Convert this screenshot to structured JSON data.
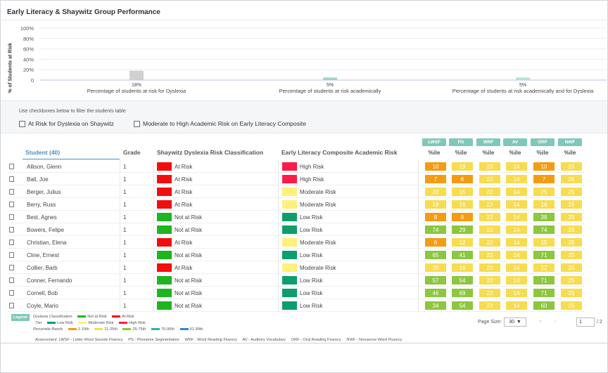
{
  "title": "Early Literacy & Shaywitz Group Performance",
  "colors": {
    "at_risk": "#f30e0e",
    "not_at_risk": "#1eb51e",
    "high_risk": "#ff1b47",
    "moderate_risk": "#fff07a",
    "low_risk": "#0c9e6c",
    "band_1_10": "#f39c12",
    "band_11_25": "#f7dc4f",
    "band_26_75": "#8dc63f",
    "band_76_90": "#2bb5a5",
    "band_91_99": "#2e8bc0"
  },
  "chart_data": {
    "type": "bar",
    "ylabel": "% of Students at Risk",
    "ylim": [
      0,
      100
    ],
    "yticks": [
      "100%",
      "80%",
      "60%",
      "40%",
      "20%",
      "0"
    ],
    "categories": [
      "Percentage of students at risk for Dyslexia",
      "Percentage of students at risk academically",
      "Percentage of students at risk academically and for Dyslexia"
    ],
    "values": [
      18,
      5,
      5
    ],
    "data_labels": [
      "18%",
      "5%",
      "5%"
    ]
  },
  "filters": {
    "hint": "Use checkboxes below to filter the students table",
    "dyslexia_label": "At Risk for Dyslexia on Shaywitz",
    "academic_label": "Moderate to High Academic Risk on Early Literacy Composite"
  },
  "table": {
    "assessments": [
      "LWSF",
      "PS",
      "WRF",
      "AV",
      "ORF",
      "NWF"
    ],
    "headers": {
      "student": "Student (40)",
      "grade": "Grade",
      "shaywitz": "Shaywitz Dyslexia Risk Classification",
      "literacy": "Early Literacy Composite Academic Risk",
      "pct": "%ile"
    },
    "rows": [
      {
        "name": "Allison, Glenn",
        "grade": "1",
        "dys": "At Risk",
        "acad": "High Risk",
        "scores": [
          10,
          19,
          22,
          14,
          10,
          25
        ]
      },
      {
        "name": "Ball, Joe",
        "grade": "1",
        "dys": "At Risk",
        "acad": "High Risk",
        "scores": [
          7,
          6,
          22,
          14,
          7,
          25
        ]
      },
      {
        "name": "Berger, Julius",
        "grade": "1",
        "dys": "At Risk",
        "acad": "Moderate Risk",
        "scores": [
          22,
          15,
          22,
          14,
          25,
          25
        ]
      },
      {
        "name": "Berry, Russ",
        "grade": "1",
        "dys": "At Risk",
        "acad": "Moderate Risk",
        "scores": [
          19,
          19,
          22,
          14,
          16,
          25
        ]
      },
      {
        "name": "Best, Agnes",
        "grade": "1",
        "dys": "Not at Risk",
        "acad": "Low Risk",
        "scores": [
          8,
          9,
          22,
          14,
          38,
          25
        ]
      },
      {
        "name": "Bowers, Felipe",
        "grade": "1",
        "dys": "Not at Risk",
        "acad": "Low Risk",
        "scores": [
          74,
          29,
          22,
          14,
          74,
          25
        ]
      },
      {
        "name": "Christian, Elena",
        "grade": "1",
        "dys": "At Risk",
        "acad": "Moderate Risk",
        "scores": [
          6,
          12,
          22,
          14,
          25,
          25
        ]
      },
      {
        "name": "Cline, Ernest",
        "grade": "1",
        "dys": "Not at Risk",
        "acad": "Low Risk",
        "scores": [
          65,
          41,
          22,
          14,
          71,
          25
        ]
      },
      {
        "name": "Collier, Barb",
        "grade": "1",
        "dys": "At Risk",
        "acad": "Moderate Risk",
        "scores": [
          20,
          16,
          22,
          14,
          22,
          25
        ]
      },
      {
        "name": "Conner, Fernando",
        "grade": "1",
        "dys": "Not at Risk",
        "acad": "Low Risk",
        "scores": [
          57,
          54,
          22,
          14,
          71,
          25
        ]
      },
      {
        "name": "Cornell, Bob",
        "grade": "1",
        "dys": "Not at Risk",
        "acad": "Low Risk",
        "scores": [
          46,
          69,
          22,
          14,
          71,
          25
        ]
      },
      {
        "name": "Coyle, Mario",
        "grade": "1",
        "dys": "Not at Risk",
        "acad": "Low Risk",
        "scores": [
          34,
          54,
          22,
          14,
          60,
          25
        ]
      }
    ]
  },
  "legend": {
    "tag": "Legend",
    "dys_label": "Dyslexia Classification",
    "dys_items": [
      "Not at Risk",
      "At Risk"
    ],
    "tier_label": "Tier",
    "tier_items": [
      "Low Risk",
      "Moderate Risk",
      "High Risk"
    ],
    "bands_label": "Percentile Bands",
    "band_items": [
      "1-10th",
      "11-25th",
      "26-75th",
      "76-90th",
      "91-99th"
    ],
    "assessment_label": "Assessment",
    "assessment_text": "LWSF - Letter Word Sounds Fluency     PS - Phoneme Segmentation     WRF - Word Reading Fluency     AV - Auditory Vocabulary     ORF - Oral Reading Fluency     NWF - Nonsense Word Fluency"
  },
  "pager": {
    "page_size_label": "Page Size:",
    "page_size": "30",
    "current_page": "1",
    "total": "/ 2"
  }
}
